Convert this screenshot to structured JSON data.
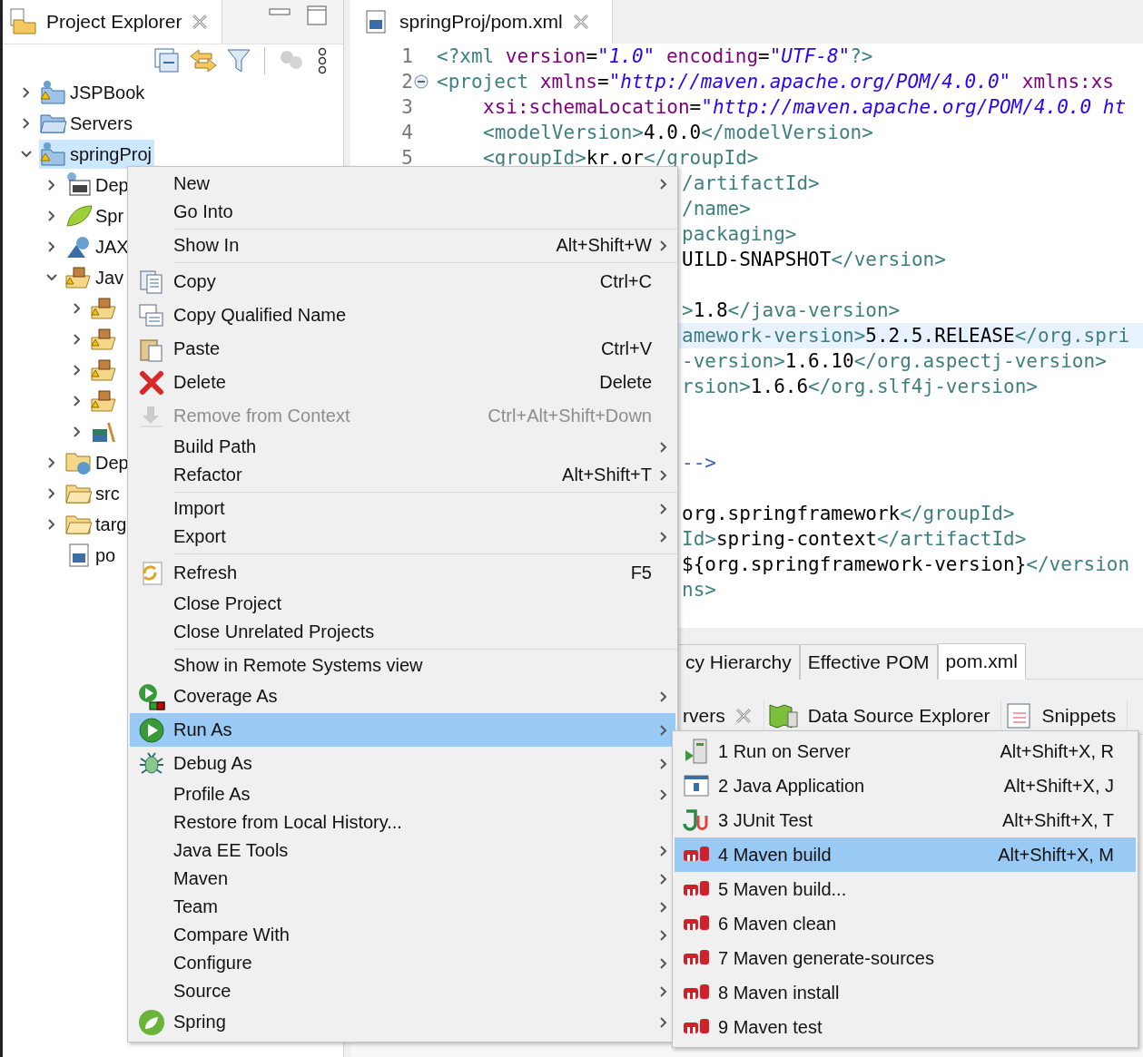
{
  "explorer": {
    "title": "Project Explorer",
    "tree": [
      {
        "label": "JSPBook",
        "kind": "project",
        "expanded": false,
        "selected": false
      },
      {
        "label": "Servers",
        "kind": "servers",
        "expanded": false,
        "selected": false
      },
      {
        "label": "springProj",
        "kind": "project",
        "expanded": true,
        "selected": true,
        "children": [
          {
            "label": "Dep",
            "kind": "descriptor",
            "expanded": false,
            "selected": false
          },
          {
            "label": "Spr",
            "kind": "leaf",
            "expanded": false,
            "selected": false
          },
          {
            "label": "JAX",
            "kind": "webservice",
            "expanded": false,
            "selected": false
          },
          {
            "label": "Jav",
            "kind": "package-folder",
            "expanded": true,
            "selected": false,
            "children": [
              {
                "kind": "package-folder",
                "expanded": false,
                "selected": false
              },
              {
                "kind": "package-folder",
                "expanded": false,
                "selected": false
              },
              {
                "kind": "package-folder",
                "expanded": false,
                "selected": false
              },
              {
                "kind": "package-folder",
                "expanded": false,
                "selected": false
              },
              {
                "kind": "library",
                "expanded": false,
                "selected": false
              }
            ]
          },
          {
            "label": "Dep",
            "kind": "globe-folder",
            "expanded": false,
            "selected": false
          },
          {
            "label": "src",
            "kind": "folder",
            "expanded": false,
            "selected": false
          },
          {
            "label": "targ",
            "kind": "folder",
            "expanded": false,
            "selected": false
          },
          {
            "label": "po",
            "kind": "file",
            "selected": false
          }
        ]
      }
    ]
  },
  "editor": {
    "tab": {
      "title": "springProj/pom.xml"
    },
    "lines": [
      {
        "kind": "full",
        "number": "1",
        "current": false,
        "segments": [
          {
            "kind": "tag",
            "text": "<?xml"
          },
          {
            "kind": "attr",
            "text": " version"
          },
          {
            "kind": "text",
            "text": "="
          },
          {
            "kind": "value",
            "text": "\"1.0\""
          },
          {
            "kind": "attr",
            "text": " encoding"
          },
          {
            "kind": "text",
            "text": "="
          },
          {
            "kind": "value",
            "text": "\"UTF-8\""
          },
          {
            "kind": "tag",
            "text": "?>"
          }
        ]
      },
      {
        "kind": "full",
        "number": "2",
        "current": false,
        "foldable": true,
        "segments": [
          {
            "kind": "tag",
            "text": "<project"
          },
          {
            "kind": "attr",
            "text": " xmlns"
          },
          {
            "kind": "text",
            "text": "="
          },
          {
            "kind": "value",
            "text": "\"http://maven.apache.org/POM/4.0.0\""
          },
          {
            "kind": "attr",
            "text": " xmlns:xs"
          }
        ]
      },
      {
        "kind": "indented",
        "number": "3",
        "current": false,
        "segments": [
          {
            "kind": "attr",
            "text": "xsi:schemaLocation"
          },
          {
            "kind": "text",
            "text": "="
          },
          {
            "kind": "value",
            "text": "\"http://maven.apache.org/POM/4.0.0 ht"
          }
        ]
      },
      {
        "kind": "indented",
        "number": "4",
        "current": false,
        "segments": [
          {
            "kind": "tag",
            "text": "<modelVersion>"
          },
          {
            "kind": "text",
            "text": "4.0.0"
          },
          {
            "kind": "tag",
            "text": "</modelVersion>"
          }
        ]
      },
      {
        "kind": "indented",
        "number": "5",
        "current": false,
        "segments": [
          {
            "kind": "tag",
            "text": "<groupId>"
          },
          {
            "kind": "text",
            "text": "kr.or"
          },
          {
            "kind": "tag",
            "text": "</groupId>"
          }
        ]
      },
      {
        "kind": "clipped",
        "current": false,
        "segments": [
          {
            "kind": "tag",
            "text": "/artifactId>"
          }
        ]
      },
      {
        "kind": "clipped",
        "current": false,
        "segments": [
          {
            "kind": "tag",
            "text": "/name>"
          }
        ]
      },
      {
        "kind": "clipped",
        "current": false,
        "segments": [
          {
            "kind": "tag",
            "text": "packaging>"
          }
        ]
      },
      {
        "kind": "clipped",
        "current": false,
        "segments": [
          {
            "kind": "text",
            "text": "UILD-SNAPSHOT"
          },
          {
            "kind": "tag",
            "text": "</version>"
          }
        ]
      },
      {
        "current": false
      },
      {
        "kind": "clipped",
        "current": false,
        "segments": [
          {
            "kind": "tag",
            "text": ">"
          },
          {
            "kind": "text",
            "text": "1.8"
          },
          {
            "kind": "tag",
            "text": "</java-version>"
          }
        ]
      },
      {
        "kind": "clipped",
        "current": true,
        "segments": [
          {
            "kind": "tag",
            "text": "amework-version>"
          },
          {
            "kind": "text",
            "text": "5.2.5.RELEASE"
          },
          {
            "kind": "tag",
            "text": "</org.spri"
          }
        ]
      },
      {
        "kind": "clipped",
        "current": false,
        "segments": [
          {
            "kind": "tag",
            "text": "-version>"
          },
          {
            "kind": "text",
            "text": "1.6.10"
          },
          {
            "kind": "tag",
            "text": "</org.aspectj-version>"
          }
        ]
      },
      {
        "kind": "clipped",
        "current": false,
        "segments": [
          {
            "kind": "tag",
            "text": "rsion>"
          },
          {
            "kind": "text",
            "text": "1.6.6"
          },
          {
            "kind": "tag",
            "text": "</org.slf4j-version>"
          }
        ]
      },
      {
        "current": false
      },
      {
        "current": false
      },
      {
        "kind": "clipped",
        "current": false,
        "segments": [
          {
            "kind": "comment",
            "text": "-->"
          }
        ]
      },
      {
        "current": false
      },
      {
        "kind": "clipped",
        "current": false,
        "segments": [
          {
            "kind": "text",
            "text": "org.springframework"
          },
          {
            "kind": "tag",
            "text": "</groupId>"
          }
        ]
      },
      {
        "kind": "clipped",
        "current": false,
        "segments": [
          {
            "kind": "tag",
            "text": "Id>"
          },
          {
            "kind": "text",
            "text": "spring-context"
          },
          {
            "kind": "tag",
            "text": "</artifactId>"
          }
        ]
      },
      {
        "kind": "clipped",
        "current": false,
        "segments": [
          {
            "kind": "text",
            "text": "${org.springframework-version}"
          },
          {
            "kind": "tag",
            "text": "</version"
          }
        ]
      },
      {
        "kind": "clipped",
        "current": false,
        "segments": [
          {
            "kind": "tag",
            "text": "ns>"
          }
        ]
      }
    ],
    "page_tabs": [
      {
        "label": "cy Hierarchy",
        "selected": false
      },
      {
        "label": "Effective POM",
        "selected": false
      },
      {
        "label": "pom.xml",
        "selected": true
      }
    ]
  },
  "bottom_views": {
    "tabs": [
      {
        "label": "rvers",
        "kind": "plain",
        "closable": true
      },
      {
        "label": "Data Source Explorer",
        "kind": "map",
        "closable": false
      },
      {
        "label": "Snippets",
        "kind": "snippets",
        "closable": false
      }
    ]
  },
  "context_menu": {
    "groups": [
      [
        {
          "label": "New",
          "kind": "plain",
          "submenu": true,
          "disabled": false,
          "selected": false
        },
        {
          "label": "Go Into",
          "kind": "plain",
          "submenu": false,
          "disabled": false,
          "selected": false
        }
      ],
      [
        {
          "label": "Show In",
          "kind": "plain",
          "shortcut": "Alt+Shift+W",
          "submenu": true,
          "disabled": false,
          "selected": false
        }
      ],
      [
        {
          "label": "Copy",
          "kind": "copy",
          "shortcut": "Ctrl+C",
          "submenu": false,
          "disabled": false,
          "selected": false
        },
        {
          "label": "Copy Qualified Name",
          "kind": "copy-qualified",
          "submenu": false,
          "disabled": false,
          "selected": false
        },
        {
          "label": "Paste",
          "kind": "paste",
          "shortcut": "Ctrl+V",
          "submenu": false,
          "disabled": false,
          "selected": false
        },
        {
          "label": "Delete",
          "kind": "delete",
          "shortcut": "Delete",
          "submenu": false,
          "disabled": false,
          "selected": false
        },
        {
          "label": "Remove from Context",
          "kind": "remove",
          "shortcut": "Ctrl+Alt+Shift+Down",
          "submenu": false,
          "disabled": true,
          "selected": false
        },
        {
          "label": "Build Path",
          "kind": "plain",
          "submenu": true,
          "disabled": false,
          "selected": false
        },
        {
          "label": "Refactor",
          "kind": "plain",
          "shortcut": "Alt+Shift+T",
          "submenu": true,
          "disabled": false,
          "selected": false
        }
      ],
      [
        {
          "label": "Import",
          "kind": "plain",
          "submenu": true,
          "disabled": false,
          "selected": false
        },
        {
          "label": "Export",
          "kind": "plain",
          "submenu": true,
          "disabled": false,
          "selected": false
        }
      ],
      [
        {
          "label": "Refresh",
          "kind": "refresh",
          "shortcut": "F5",
          "submenu": false,
          "disabled": false,
          "selected": false
        },
        {
          "label": "Close Project",
          "kind": "plain",
          "submenu": false,
          "disabled": false,
          "selected": false
        },
        {
          "label": "Close Unrelated Projects",
          "kind": "plain",
          "submenu": false,
          "disabled": false,
          "selected": false
        }
      ],
      [
        {
          "label": "Show in Remote Systems view",
          "kind": "plain",
          "submenu": false,
          "disabled": false,
          "selected": false
        },
        {
          "label": "Coverage As",
          "kind": "coverage",
          "submenu": true,
          "disabled": false,
          "selected": false
        },
        {
          "label": "Run As",
          "kind": "run",
          "submenu": true,
          "disabled": false,
          "selected": true
        },
        {
          "label": "Debug As",
          "kind": "debug",
          "submenu": true,
          "disabled": false,
          "selected": false
        },
        {
          "label": "Profile As",
          "kind": "plain",
          "submenu": true,
          "disabled": false,
          "selected": false
        },
        {
          "label": "Restore from Local History...",
          "kind": "plain",
          "submenu": false,
          "disabled": false,
          "selected": false
        },
        {
          "label": "Java EE Tools",
          "kind": "plain",
          "submenu": true,
          "disabled": false,
          "selected": false
        },
        {
          "label": "Maven",
          "kind": "plain",
          "submenu": true,
          "disabled": false,
          "selected": false
        },
        {
          "label": "Team",
          "kind": "plain",
          "submenu": true,
          "disabled": false,
          "selected": false
        },
        {
          "label": "Compare With",
          "kind": "plain",
          "submenu": true,
          "disabled": false,
          "selected": false
        },
        {
          "label": "Configure",
          "kind": "plain",
          "submenu": true,
          "disabled": false,
          "selected": false
        },
        {
          "label": "Source",
          "kind": "plain",
          "submenu": true,
          "disabled": false,
          "selected": false
        },
        {
          "label": "Spring",
          "kind": "spring",
          "submenu": true,
          "disabled": false,
          "selected": false
        }
      ]
    ]
  },
  "run_as_menu": {
    "items": [
      {
        "label": "1 Run on Server",
        "kind": "server",
        "shortcut": "Alt+Shift+X, R",
        "selected": false
      },
      {
        "label": "2 Java Application",
        "kind": "window",
        "shortcut": "Alt+Shift+X, J",
        "selected": false
      },
      {
        "label": "3 JUnit Test",
        "kind": "junit",
        "shortcut": "Alt+Shift+X, T",
        "selected": false
      },
      {
        "label": "4 Maven build",
        "kind": "maven",
        "shortcut": "Alt+Shift+X, M",
        "selected": true
      },
      {
        "label": "5 Maven build...",
        "kind": "maven",
        "selected": false
      },
      {
        "label": "6 Maven clean",
        "kind": "maven",
        "selected": false
      },
      {
        "label": "7 Maven generate-sources",
        "kind": "maven",
        "selected": false
      },
      {
        "label": "8 Maven install",
        "kind": "maven",
        "selected": false
      },
      {
        "label": "9 Maven test",
        "kind": "maven",
        "selected": false
      }
    ]
  }
}
